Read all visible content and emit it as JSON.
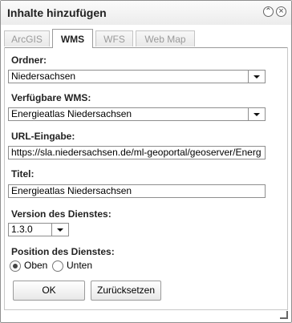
{
  "window": {
    "title": "Inhalte hinzufügen"
  },
  "tabs": [
    "ArcGIS",
    "WMS",
    "WFS",
    "Web Map"
  ],
  "form": {
    "ordner_label": "Ordner:",
    "ordner_value": "Niedersachsen",
    "wms_label": "Verfügbare WMS:",
    "wms_value": "Energieatlas Niedersachsen",
    "url_label": "URL-Eingabe:",
    "url_value": "https://sla.niedersachsen.de/ml-geoportal/geoserver/Energ",
    "titel_label": "Titel:",
    "titel_value": "Energieatlas Niedersachsen",
    "version_label": "Version des Dienstes:",
    "version_value": "1.3.0",
    "position_label": "Position des Dienstes:",
    "option_oben": "Oben",
    "option_unten": "Unten",
    "position_selected": "Oben"
  },
  "buttons": {
    "ok": "OK",
    "reset": "Zurücksetzen"
  }
}
